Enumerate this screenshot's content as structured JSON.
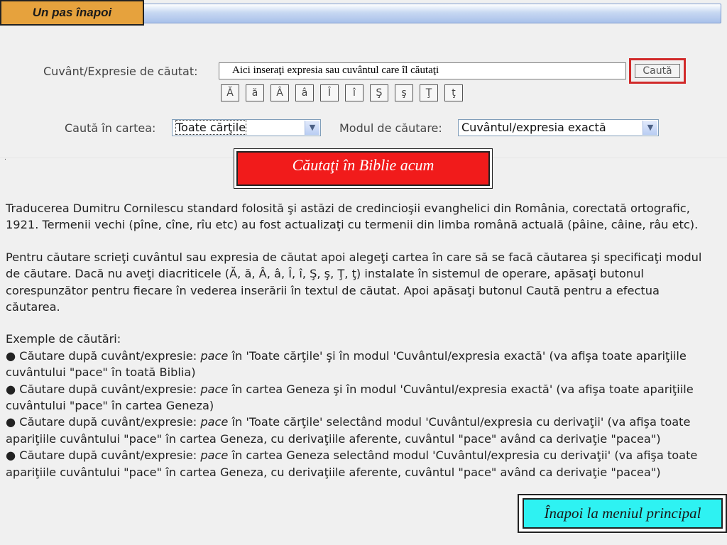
{
  "nav": {
    "back_label": "Un pas înapoi",
    "home_label": "Înapoi la meniul principal"
  },
  "search": {
    "label": "Cuvânt/Expresie de căutat:",
    "value": "Aici inseraţi expresia sau cuvântul care îl căutaţi",
    "button_label": "Caută",
    "chars": [
      "Ă",
      "ă",
      "Â",
      "â",
      "Î",
      "î",
      "Ş",
      "ş",
      "Ţ",
      "ţ"
    ]
  },
  "filters": {
    "book_label": "Caută în cartea:",
    "book_value": "Toate cărţile",
    "mode_label": "Modul de căutare:",
    "mode_value": "Cuvântul/expresia exactă"
  },
  "search_bible_label": "Căutaţi în Biblie acum",
  "content": {
    "para1": "Traducerea Dumitru Cornilescu standard folosită şi astăzi de credincioşii evanghelici din România, corectată ortografic, 1921. Termenii vechi (pîne, cîne, rîu etc) au fost actualizaţi cu termenii din limba română actuală (pâine, câine, râu etc).",
    "para2": "Pentru căutare scrieţi cuvântul sau expresia de căutat apoi alegeţi cartea în care să se facă căutarea şi specificaţi modul de căutare. Dacă nu aveţi diacriticele (Ă, ă, Â, â, Î, î, Ş, ş, Ţ, ţ) instalate în sistemul de operare, apăsaţi butonul corespunzător pentru fiecare în vederea inserării în textul de căutat. Apoi apăsaţi butonul Caută pentru a efectua căutarea.",
    "examples_title": "Exemple de căutări:",
    "examples": [
      {
        "prefix": "Căutare după cuvânt/expresie: ",
        "word": "pace",
        "rest": " în 'Toate cărţile' şi în modul 'Cuvântul/expresia exactă' (va afişa toate apariţiile cuvântului \"pace\" în toată Biblia)"
      },
      {
        "prefix": "Căutare după cuvânt/expresie: ",
        "word": "pace",
        "rest": " în cartea Geneza şi în modul 'Cuvântul/expresia exactă' (va afişa toate apariţiile cuvântului \"pace\" în cartea Geneza)"
      },
      {
        "prefix": "Căutare după cuvânt/expresie: ",
        "word": "pace",
        "rest": " în 'Toate cărţile' selectând modul 'Cuvântul/expresia cu derivaţii' (va afişa toate apariţiile cuvântului \"pace\" în cartea Geneza, cu derivaţiile aferente, cuvântul \"pace\" având ca derivaţie \"pacea\")"
      },
      {
        "prefix": "Căutare după cuvânt/expresie: ",
        "word": "pace",
        "rest": " în cartea Geneza selectând modul 'Cuvântul/expresia cu derivaţii' (va afişa toate apariţiile cuvântului \"pace\" în cartea Geneza, cu derivaţiile aferente, cuvântul \"pace\" având ca derivaţie \"pacea\")"
      }
    ]
  }
}
